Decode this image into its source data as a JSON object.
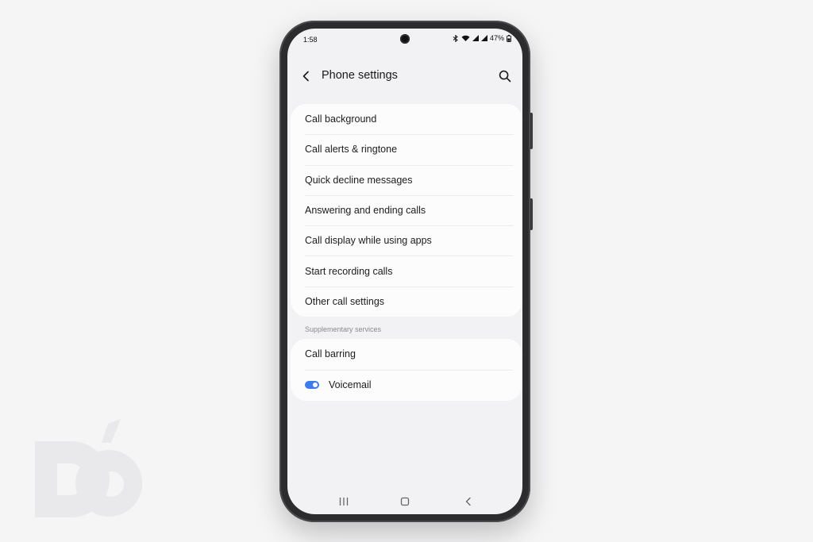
{
  "status_bar": {
    "time": "1:58",
    "battery_text": "47%",
    "icons": [
      "bluetooth-icon",
      "wifi-icon",
      "cell-signal-icon",
      "cell-signal-icon",
      "battery-icon"
    ]
  },
  "header": {
    "title": "Phone settings",
    "back_icon": "arrow-left-icon",
    "search_icon": "search-icon"
  },
  "settings": {
    "items": [
      {
        "label": "Call background"
      },
      {
        "label": "Call alerts & ringtone"
      },
      {
        "label": "Quick decline messages"
      },
      {
        "label": "Answering and ending calls"
      },
      {
        "label": "Call display while using apps"
      },
      {
        "label": "Start recording calls"
      },
      {
        "label": "Other call settings"
      }
    ]
  },
  "supplementary": {
    "section_label": "Supplementary services",
    "items": [
      {
        "label": "Call barring"
      },
      {
        "label": "Voicemail",
        "toggle_on": true
      }
    ]
  },
  "nav_bar": {
    "icons": [
      "recents-icon",
      "home-icon",
      "back-icon"
    ]
  },
  "colors": {
    "accent": "#3e7bec",
    "screen_bg": "#f2f2f4",
    "card_bg": "#fcfcfd",
    "frame": "#2c2c2e"
  }
}
